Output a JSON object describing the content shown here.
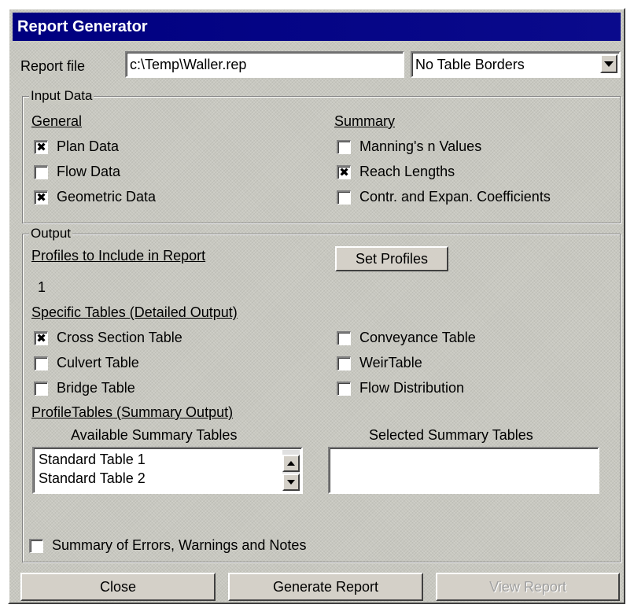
{
  "window": {
    "title": "Report Generator"
  },
  "report_file": {
    "label": "Report file",
    "value": "c:\\Temp\\Waller.rep",
    "border_option": "No Table Borders"
  },
  "input_data": {
    "title": "Input Data",
    "general": {
      "heading": "General",
      "items": [
        {
          "label": "Plan Data",
          "checked": true,
          "mark": "✖"
        },
        {
          "label": "Flow Data",
          "checked": false,
          "mark": ""
        },
        {
          "label": "Geometric Data",
          "checked": true,
          "mark": "✖"
        }
      ]
    },
    "summary": {
      "heading": "Summary",
      "items": [
        {
          "label": "Manning's n Values",
          "checked": false,
          "mark": ""
        },
        {
          "label": "Reach Lengths",
          "checked": true,
          "mark": "✖"
        },
        {
          "label": "Contr. and Expan. Coefficients",
          "checked": false,
          "mark": ""
        }
      ]
    }
  },
  "output": {
    "title": "Output",
    "profiles_heading": "Profiles to Include in Report",
    "set_profiles_label": "Set Profiles",
    "profiles_value": "1",
    "specific_heading": "Specific Tables (Detailed Output)",
    "specific_left": [
      {
        "label": "Cross Section Table",
        "checked": true,
        "mark": "✖"
      },
      {
        "label": "Culvert Table",
        "checked": false,
        "mark": ""
      },
      {
        "label": "Bridge Table",
        "checked": false,
        "mark": ""
      }
    ],
    "specific_right": [
      {
        "label": "Conveyance Table",
        "checked": false,
        "mark": ""
      },
      {
        "label": "WeirTable",
        "checked": false,
        "mark": ""
      },
      {
        "label": "Flow Distribution",
        "checked": false,
        "mark": ""
      }
    ],
    "profile_tables_heading": "ProfileTables (Summary Output)",
    "available_label": "Available Summary Tables",
    "available_items": [
      "Standard Table 1",
      "Standard Table 2"
    ],
    "selected_label": "Selected Summary Tables",
    "selected_items": []
  },
  "summary_errors": {
    "label": "Summary of Errors, Warnings and Notes",
    "checked": false,
    "mark": ""
  },
  "buttons": {
    "close": "Close",
    "generate": "Generate Report",
    "view": "View Report"
  },
  "colors": {
    "title_bar": "#000080",
    "window_face": "#c8c8c0",
    "disabled_text": "#a0a0a0"
  }
}
